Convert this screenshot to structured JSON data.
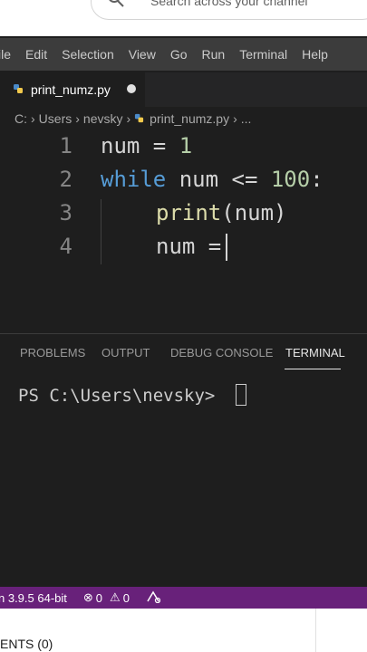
{
  "search": {
    "placeholder": "Search across your channel"
  },
  "menu": [
    "ile",
    "Edit",
    "Selection",
    "View",
    "Go",
    "Run",
    "Terminal",
    "Help"
  ],
  "tab": {
    "filename": "print_numz.py"
  },
  "breadcrumb": {
    "drive": "C:",
    "users": "Users",
    "user": "nevsky",
    "file": "print_numz.py",
    "more": "..."
  },
  "editor": {
    "line_numbers": [
      "1",
      "2",
      "3",
      "4"
    ],
    "line1": {
      "var": "num",
      "op": " = ",
      "val": "1"
    },
    "line2": {
      "kw": "while",
      "rest": " num <= ",
      "val": "100",
      "colon": ":"
    },
    "line3": {
      "fn": "print",
      "args": "(num)"
    },
    "line4": {
      "text": "num ="
    }
  },
  "panel": {
    "tabs": [
      "PROBLEMS",
      "OUTPUT",
      "DEBUG CONSOLE",
      "TERMINAL"
    ],
    "active_tab": "TERMINAL",
    "prompt": "PS C:\\Users\\nevsky>"
  },
  "status": {
    "python": "n 3.9.5 64-bit",
    "errors": "0",
    "warnings": "0"
  },
  "bottom": {
    "label": "ENTS (0)"
  },
  "colors": {
    "status_bar": "#68217a",
    "keyword": "#569cd6",
    "number": "#b5cea8"
  }
}
